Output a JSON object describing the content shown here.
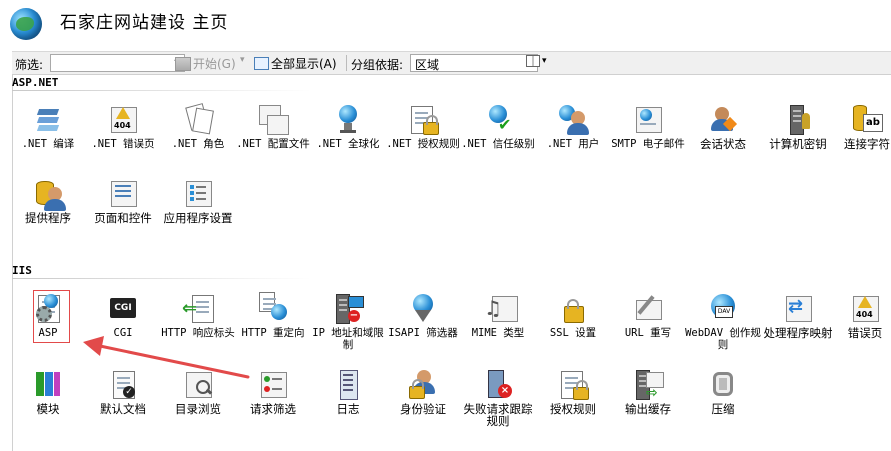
{
  "header": {
    "title": "石家庄网站建设 主页"
  },
  "toolbar": {
    "filter_label": "筛选:",
    "filter_value": "",
    "start_label": "开始(G)",
    "show_all_label": "全部显示(A)",
    "group_label": "分组依据:",
    "group_value": "区域"
  },
  "sections": {
    "aspnet": {
      "title": "ASP.NET",
      "items": [
        {
          "label": ".NET 编译",
          "icon": "compile-icon"
        },
        {
          "label": ".NET 错误页",
          "icon": "error-page-404-icon"
        },
        {
          "label": ".NET 角色",
          "icon": "roles-icon"
        },
        {
          "label": ".NET 配置文件",
          "icon": "profile-icon"
        },
        {
          "label": ".NET 全球化",
          "icon": "globe-icon"
        },
        {
          "label": ".NET 授权规则",
          "icon": "authorization-lock-icon"
        },
        {
          "label": ".NET 信任级别",
          "icon": "trust-level-icon"
        },
        {
          "label": ".NET 用户",
          "icon": "users-icon"
        },
        {
          "label": "SMTP 电子邮件",
          "icon": "smtp-email-icon"
        },
        {
          "label": "会话状态",
          "icon": "session-state-icon"
        },
        {
          "label": "计算机密钥",
          "icon": "machine-key-icon"
        },
        {
          "label": "连接字符",
          "icon": "connection-string-icon"
        },
        {
          "label": "提供程序",
          "icon": "providers-icon"
        },
        {
          "label": "页面和控件",
          "icon": "pages-controls-icon"
        },
        {
          "label": "应用程序设置",
          "icon": "app-settings-icon"
        }
      ]
    },
    "iis": {
      "title": "IIS",
      "items": [
        {
          "label": "ASP",
          "icon": "asp-icon"
        },
        {
          "label": "CGI",
          "icon": "cgi-icon"
        },
        {
          "label": "HTTP 响应标头",
          "icon": "http-headers-icon"
        },
        {
          "label": "HTTP 重定向",
          "icon": "http-redirect-icon"
        },
        {
          "label": "IP 地址和域限制",
          "icon": "ip-restrictions-icon"
        },
        {
          "label": "ISAPI 筛选器",
          "icon": "isapi-filter-icon"
        },
        {
          "label": "MIME 类型",
          "icon": "mime-types-icon"
        },
        {
          "label": "SSL 设置",
          "icon": "ssl-lock-icon"
        },
        {
          "label": "URL 重写",
          "icon": "url-rewrite-icon"
        },
        {
          "label": "WebDAV 创作规则",
          "icon": "webdav-icon"
        },
        {
          "label": "处理程序映射",
          "icon": "handler-mappings-icon"
        },
        {
          "label": "错误页",
          "icon": "error-pages-404-icon"
        },
        {
          "label": "模块",
          "icon": "modules-icon"
        },
        {
          "label": "默认文档",
          "icon": "default-document-icon"
        },
        {
          "label": "目录浏览",
          "icon": "directory-browsing-icon"
        },
        {
          "label": "请求筛选",
          "icon": "request-filtering-icon"
        },
        {
          "label": "日志",
          "icon": "logging-icon"
        },
        {
          "label": "身份验证",
          "icon": "authentication-icon"
        },
        {
          "label": "失败请求跟踪规则",
          "icon": "failed-request-icon"
        },
        {
          "label": "授权规则",
          "icon": "authorization-rules-icon"
        },
        {
          "label": "输出缓存",
          "icon": "output-cache-icon"
        },
        {
          "label": "压缩",
          "icon": "compression-icon"
        }
      ]
    }
  },
  "colors": {
    "annotation_red": "#e24a4a",
    "accent_blue": "#2a8fd6"
  }
}
